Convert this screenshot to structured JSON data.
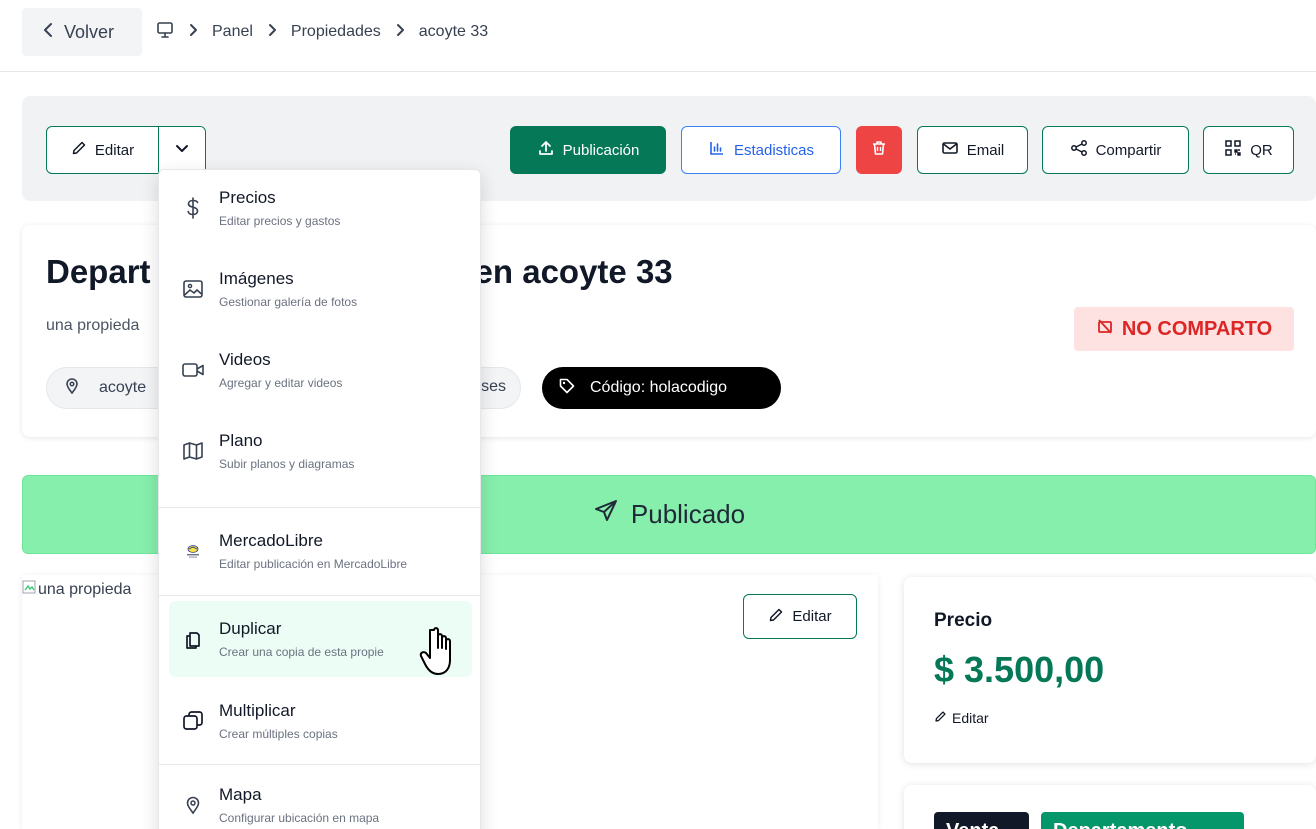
{
  "breadcrumb": {
    "back_label": "Volver",
    "items": [
      "Panel",
      "Propiedades",
      "acoyte 33"
    ]
  },
  "toolbar": {
    "edit_label": "Editar",
    "publish_label": "Publicación",
    "stats_label": "Estadisticas",
    "email_label": "Email",
    "share_label": "Compartir",
    "qr_label": "QR"
  },
  "property": {
    "title_visible_left": "Depart",
    "title_visible_right": "en acoyte 33",
    "subtitle_visible": "una propieda",
    "share_status": "NO COMPARTO",
    "location_visible": "acoyte",
    "location_tail_visible": "ses",
    "code_label": "Código: holacodigo"
  },
  "banner": {
    "label": "Publicado"
  },
  "image": {
    "alt_visible": "una propieda",
    "edit_label": "Editar"
  },
  "price": {
    "label": "Precio",
    "value": "$ 3.500,00",
    "edit_label": "Editar"
  },
  "badges": {
    "venta": "Venta",
    "tipo": "Departamento"
  },
  "menu": {
    "items": [
      {
        "label": "Precios",
        "desc": "Editar precios y gastos",
        "icon": "dollar-icon"
      },
      {
        "label": "Imágenes",
        "desc": "Gestionar galería de fotos",
        "icon": "image-icon"
      },
      {
        "label": "Videos",
        "desc": "Agregar y editar videos",
        "icon": "video-icon"
      },
      {
        "label": "Plano",
        "desc": "Subir planos y diagramas",
        "icon": "map-icon"
      },
      {
        "label": "MercadoLibre",
        "desc": "Editar publicación en MercadoLibre",
        "icon": "mercadolibre-logo"
      },
      {
        "label": "Duplicar",
        "desc": "Crear una copia de esta propie",
        "icon": "copy-icon"
      },
      {
        "label": "Multiplicar",
        "desc": "Crear múltiples copias",
        "icon": "multiply-icon"
      },
      {
        "label": "Mapa",
        "desc": "Configurar ubicación en mapa",
        "icon": "pin-icon"
      }
    ]
  },
  "colors": {
    "primary_green": "#047857",
    "banner_green": "#86efac",
    "danger_red": "#ef4444",
    "stats_blue": "#3b82f6",
    "no_share_red": "#dc2626"
  }
}
